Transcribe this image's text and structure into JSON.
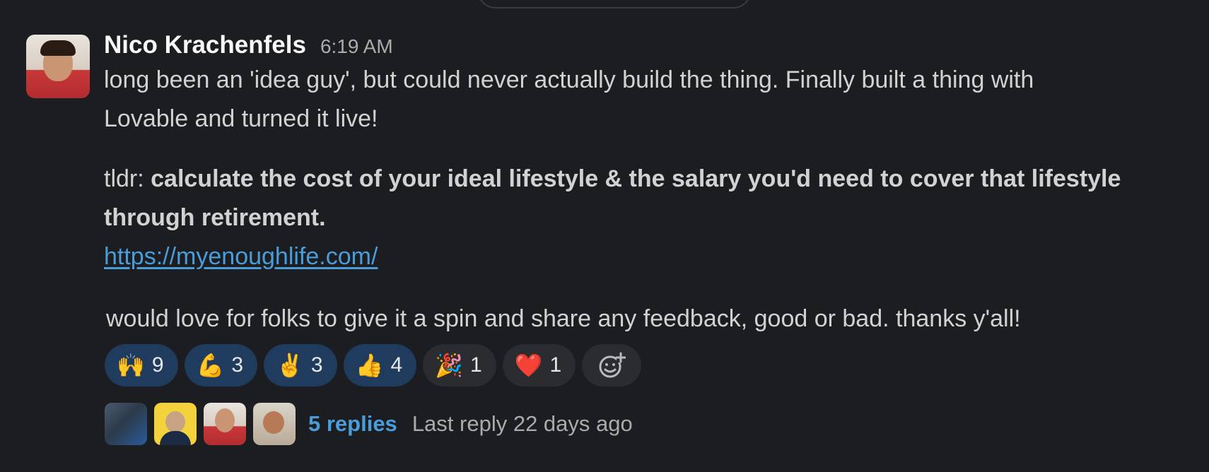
{
  "message": {
    "author": "Nico Krachenfels",
    "timestamp": "6:19 AM",
    "line1": "long been an 'idea guy', but could never actually build the thing. Finally built a thing with",
    "line2": "Lovable and turned it live!",
    "tldr_prefix": "tldr: ",
    "tldr_bold_line1": "calculate the cost of your ideal lifestyle & the salary you'd need to cover that lifestyle",
    "tldr_bold_line2": "through retirement.",
    "link": "https://myenoughlife.com/",
    "closing": "would love for folks to give it a spin and share any feedback, good or bad. thanks y'all!"
  },
  "reactions": [
    {
      "emoji": "🙌",
      "icon": "raised-hands-icon",
      "count": "9",
      "active": true
    },
    {
      "emoji": "💪",
      "icon": "flexed-biceps-icon",
      "count": "3",
      "active": true
    },
    {
      "emoji": "✌️",
      "icon": "victory-hand-icon",
      "count": "3",
      "active": true
    },
    {
      "emoji": "👍",
      "icon": "thumbs-up-icon",
      "count": "4",
      "active": true
    },
    {
      "emoji": "🎉",
      "icon": "party-popper-icon",
      "count": "1",
      "active": false
    },
    {
      "emoji": "❤️",
      "icon": "red-heart-icon",
      "count": "1",
      "active": false
    }
  ],
  "thread": {
    "replies": "5 replies",
    "last_reply": "Last reply 22 days ago"
  },
  "colors": {
    "background": "#1b1d21",
    "link": "#4a9dd9",
    "active_reaction": "#1f3c5f",
    "inactive_reaction": "#2a2c30"
  }
}
